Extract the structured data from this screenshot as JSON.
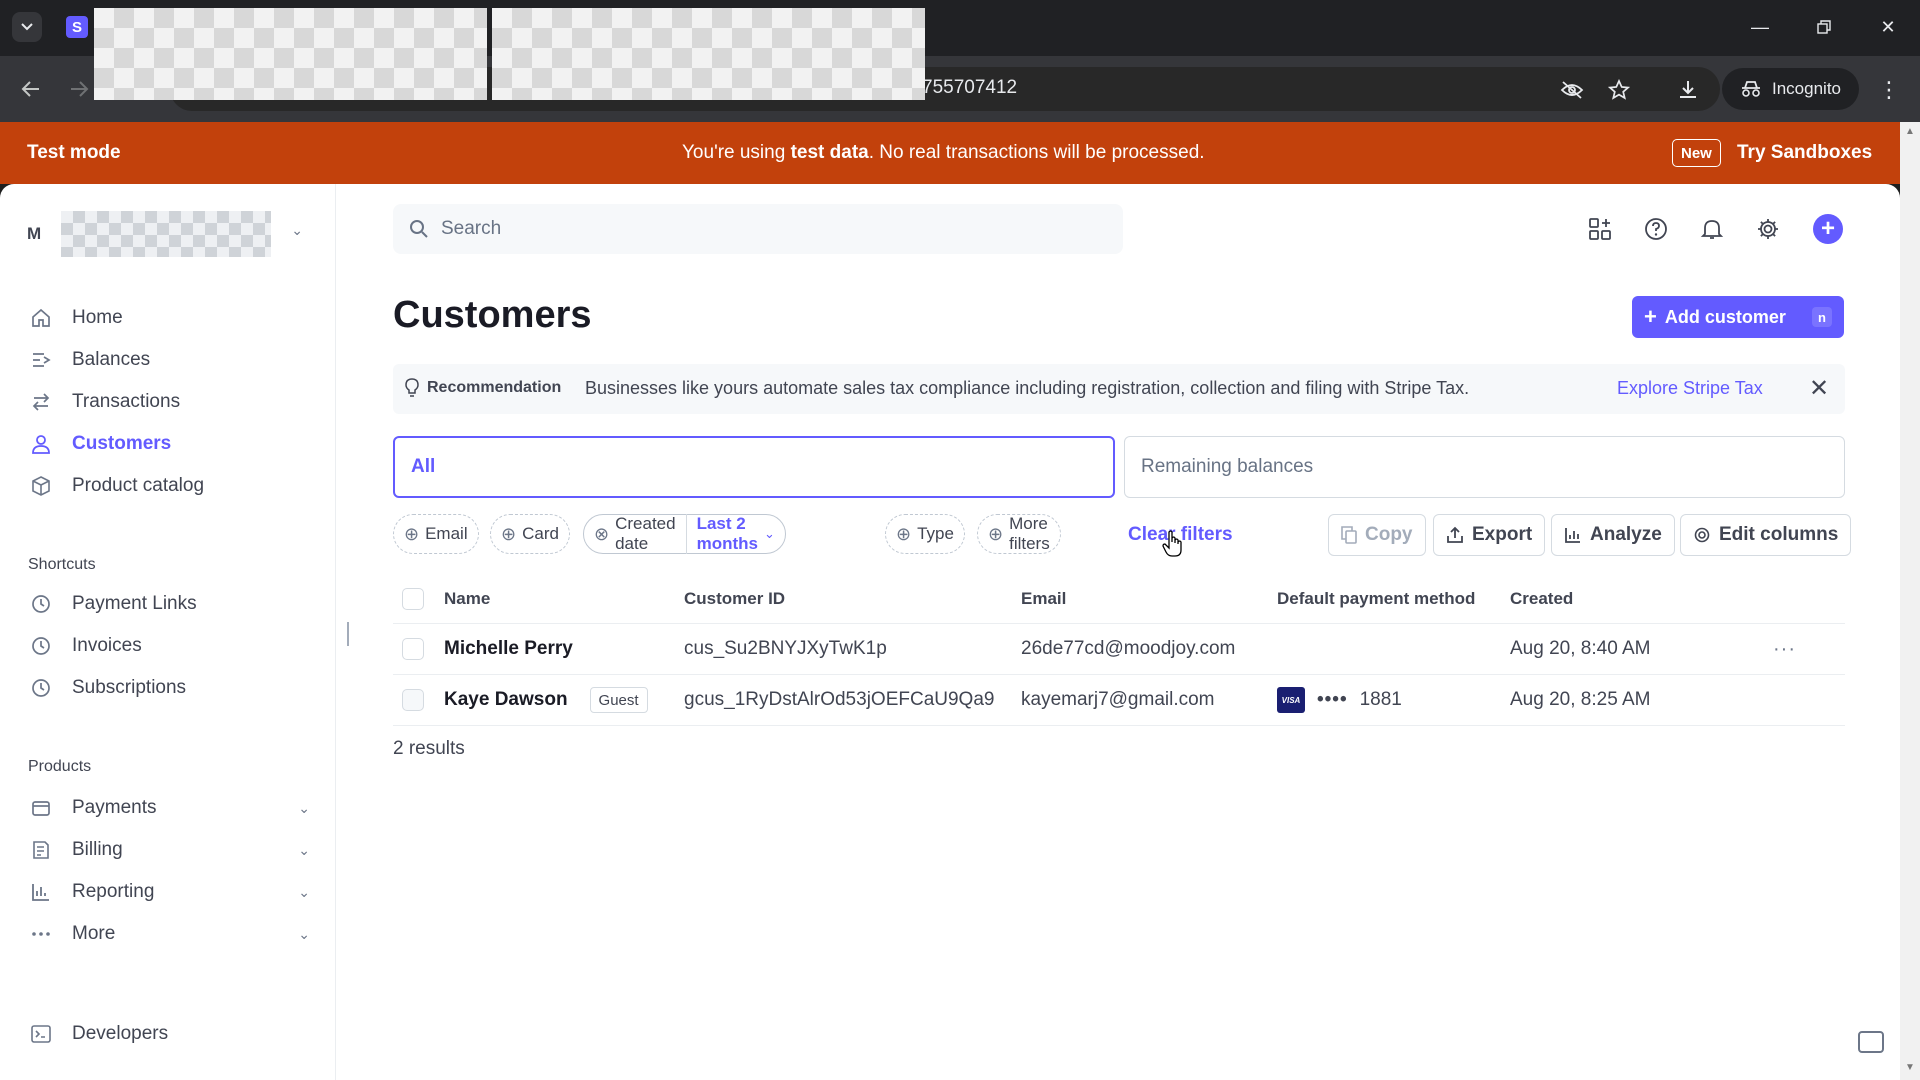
{
  "browser": {
    "url_suffix": "755707412",
    "favicon_letter": "S",
    "incognito_label": "Incognito"
  },
  "banner": {
    "title": "Test mode",
    "message_pre": "You're using ",
    "message_bold": "test data",
    "message_post": ". No real transactions will be processed.",
    "new_badge": "New",
    "sandboxes_link": "Try Sandboxes"
  },
  "sidebar": {
    "account_letter": "M",
    "nav": [
      {
        "label": "Home",
        "icon": "home-icon"
      },
      {
        "label": "Balances",
        "icon": "balances-icon"
      },
      {
        "label": "Transactions",
        "icon": "transactions-icon"
      },
      {
        "label": "Customers",
        "icon": "customers-icon",
        "active": true
      },
      {
        "label": "Product catalog",
        "icon": "product-catalog-icon"
      }
    ],
    "shortcuts_label": "Shortcuts",
    "shortcuts": [
      {
        "label": "Payment Links",
        "icon": "clock-icon"
      },
      {
        "label": "Invoices",
        "icon": "clock-icon"
      },
      {
        "label": "Subscriptions",
        "icon": "clock-icon"
      }
    ],
    "products_label": "Products",
    "products": [
      {
        "label": "Payments",
        "icon": "payments-icon"
      },
      {
        "label": "Billing",
        "icon": "billing-icon"
      },
      {
        "label": "Reporting",
        "icon": "reporting-icon"
      },
      {
        "label": "More",
        "icon": "more-icon"
      }
    ],
    "developers": "Developers"
  },
  "header": {
    "search_placeholder": "Search"
  },
  "page": {
    "title": "Customers",
    "add_button": "Add customer",
    "add_shortcut": "n"
  },
  "recommendation": {
    "label": "Recommendation",
    "text": "Businesses like yours automate sales tax compliance including registration, collection and filing with Stripe Tax.",
    "link": "Explore Stripe Tax"
  },
  "segments": {
    "all": "All",
    "remaining": "Remaining balances"
  },
  "filters": {
    "email": "Email",
    "card": "Card",
    "created_date": "Created date",
    "created_value": "Last 2 months",
    "type": "Type",
    "more": "More filters",
    "clear": "Clear filters"
  },
  "actions": {
    "copy": "Copy",
    "export": "Export",
    "analyze": "Analyze",
    "edit_columns": "Edit columns"
  },
  "table": {
    "columns": [
      "Name",
      "Customer ID",
      "Email",
      "Default payment method",
      "Created"
    ],
    "rows": [
      {
        "name": "Michelle Perry",
        "badge": "",
        "id": "cus_Su2BNYJXyTwK1p",
        "email": "26de77cd@moodjoy.com",
        "payment": "",
        "created": "Aug 20, 8:40 AM"
      },
      {
        "name": "Kaye Dawson",
        "badge": "Guest",
        "id": "gcus_1RyDstAlrOd53jOEFCaU9Qa9",
        "email": "kayemarj7@gmail.com",
        "card_brand": "VISA",
        "card_dots": "••••",
        "card_last4": "1881",
        "created": "Aug 20, 8:25 AM"
      }
    ],
    "results": "2 results"
  }
}
